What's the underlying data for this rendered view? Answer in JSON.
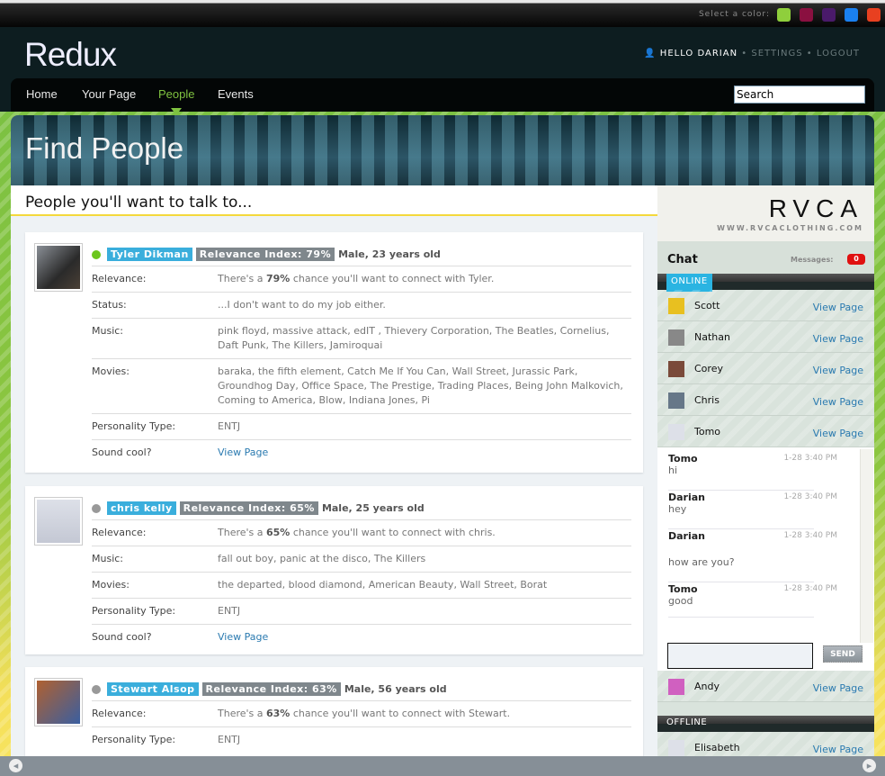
{
  "topbar": {
    "color_label": "Select a color:",
    "colors": [
      "#8fcf3c",
      "#8a1040",
      "#4a1a6a",
      "#1a80f0",
      "#e84020"
    ]
  },
  "header": {
    "logo": "Redux",
    "hello": "HELLO DARIAN",
    "settings": "SETTINGS",
    "logout": "LOGOUT",
    "sep": "•"
  },
  "nav": {
    "items": [
      "Home",
      "Your Page",
      "People",
      "Events"
    ],
    "active": "People",
    "search_value": "Search"
  },
  "banner": {
    "title": "Find People"
  },
  "main": {
    "heading": "People you'll want to talk to...",
    "people": [
      {
        "name": "Tyler Dikman",
        "relevance": "Relevance Index: 79%",
        "demo": "Male, 23 years old",
        "online": true,
        "rows": [
          [
            "Relevance:",
            "There's a |79%| chance you'll want to connect with Tyler."
          ],
          [
            "Status:",
            "...I don't want to do my job either."
          ],
          [
            "Music:",
            "pink floyd, massive attack, edIT , Thievery Corporation, The Beatles, Cornelius, Daft Punk, The Killers, Jamiroquai"
          ],
          [
            "Movies:",
            "baraka, the fifth element, Catch Me If You Can, Wall Street, Jurassic Park, Groundhog Day, Office Space, The Prestige, Trading Places, Being John Malkovich, Coming to America, Blow, Indiana Jones, Pi"
          ],
          [
            "Personality Type:",
            "ENTJ"
          ],
          [
            "Sound cool?",
            "View Page"
          ]
        ]
      },
      {
        "name": "chris kelly",
        "relevance": "Relevance Index: 65%",
        "demo": "Male, 25 years old",
        "online": false,
        "rows": [
          [
            "Relevance:",
            "There's a |65%| chance you'll want to connect with chris."
          ],
          [
            "Music:",
            "fall out boy, panic at the disco, The Killers"
          ],
          [
            "Movies:",
            "the departed, blood diamond, American Beauty, Wall Street, Borat"
          ],
          [
            "Personality Type:",
            "ENTJ"
          ],
          [
            "Sound cool?",
            "View Page"
          ]
        ]
      },
      {
        "name": "Stewart Alsop",
        "relevance": "Relevance Index: 63%",
        "demo": "Male, 56 years old",
        "online": false,
        "rows": [
          [
            "Relevance:",
            "There's a |63%| chance you'll want to connect with Stewart."
          ],
          [
            "Personality Type:",
            "ENTJ"
          ]
        ]
      }
    ]
  },
  "sidebar": {
    "ad_brand": "RVCA",
    "ad_url": "WWW.RVCACLOTHING.COM",
    "chat_title": "Chat",
    "messages_label": "Messages:",
    "messages_count": "0",
    "online_label": "ONLINE",
    "offline_label": "OFFLINE",
    "view_page": "View Page",
    "online": [
      "Scott",
      "Nathan",
      "Corey",
      "Chris",
      "Tomo"
    ],
    "online_after": [
      "Andy"
    ],
    "offline": [
      "Elisabeth"
    ],
    "messages": [
      {
        "who": "Tomo",
        "time": "1-28 3:40 PM",
        "text": "hi"
      },
      {
        "who": "Darian",
        "time": "1-28 3:40 PM",
        "text": "hey"
      },
      {
        "who": "Darian",
        "time": "1-28 3:40 PM",
        "text": "how are you?"
      },
      {
        "who": "Tomo",
        "time": "1-28 3:40 PM",
        "text": "good"
      }
    ],
    "send": "SEND"
  }
}
